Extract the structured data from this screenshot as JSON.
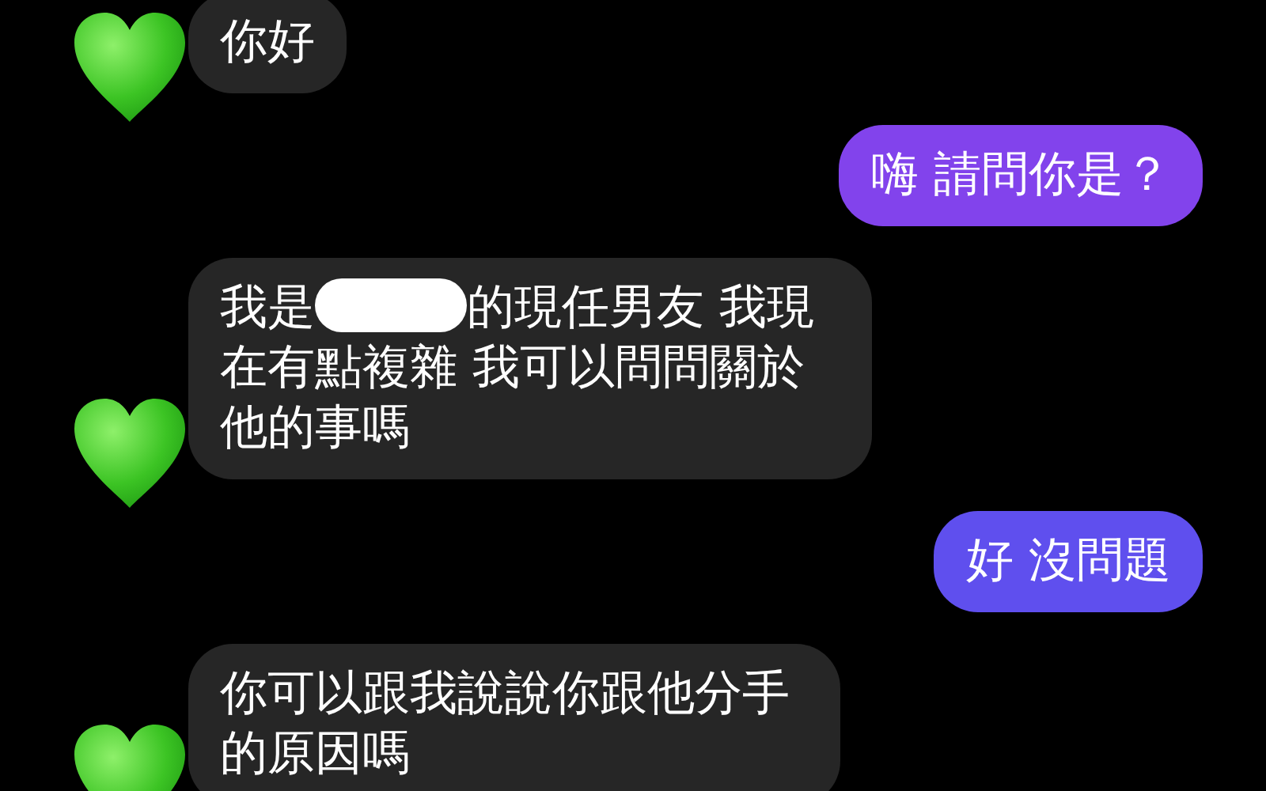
{
  "messages": [
    {
      "outgoing": false,
      "kind": "plain",
      "text": "你好"
    },
    {
      "outgoing": true,
      "kind": "plain",
      "text": "嗨 請問你是？",
      "color": "#8243ec"
    },
    {
      "outgoing": false,
      "kind": "redacted",
      "segments": [
        "我是",
        "的現任男友 我現",
        "在有點複雜 我可以問問關於他的事嗎"
      ]
    },
    {
      "outgoing": true,
      "kind": "plain",
      "text": "好 沒問題",
      "color": "#5f4fee"
    },
    {
      "outgoing": false,
      "kind": "plain",
      "text": "你可以跟我說說你跟他分手的原因嗎"
    }
  ]
}
